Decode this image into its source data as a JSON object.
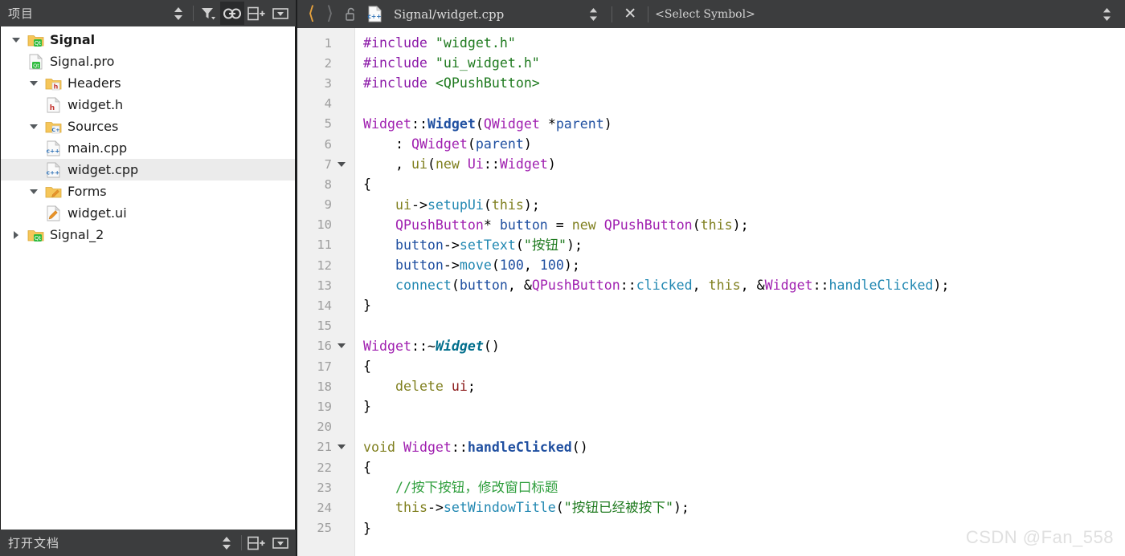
{
  "sidebar": {
    "title": "项目",
    "toolbar": [
      {
        "name": "sort-icon",
        "label": "排序"
      },
      {
        "name": "filter-icon",
        "label": "筛选"
      },
      {
        "name": "link-icon",
        "label": "与编辑器同步",
        "active": true
      },
      {
        "name": "split-add-icon",
        "label": "添加分栏"
      },
      {
        "name": "close-panel-icon",
        "label": "关闭边栏"
      }
    ],
    "tree": [
      {
        "label": "Signal",
        "indent": 0,
        "icon": "qt-folder-icon",
        "twisty": "down",
        "bold": true,
        "selected": false
      },
      {
        "label": "Signal.pro",
        "indent": 1,
        "icon": "qt-pro-file-icon",
        "twisty": "none",
        "bold": false,
        "selected": false
      },
      {
        "label": "Headers",
        "indent": 1,
        "icon": "h-folder-icon",
        "twisty": "down",
        "bold": false,
        "selected": false
      },
      {
        "label": "widget.h",
        "indent": 2,
        "icon": "h-file-icon",
        "twisty": "none",
        "bold": false,
        "selected": false
      },
      {
        "label": "Sources",
        "indent": 1,
        "icon": "cpp-folder-icon",
        "twisty": "down",
        "bold": false,
        "selected": false
      },
      {
        "label": "main.cpp",
        "indent": 2,
        "icon": "cpp-file-icon",
        "twisty": "none",
        "bold": false,
        "selected": false
      },
      {
        "label": "widget.cpp",
        "indent": 2,
        "icon": "cpp-file-icon",
        "twisty": "none",
        "bold": false,
        "selected": true
      },
      {
        "label": "Forms",
        "indent": 1,
        "icon": "ui-folder-icon",
        "twisty": "down",
        "bold": false,
        "selected": false
      },
      {
        "label": "widget.ui",
        "indent": 2,
        "icon": "ui-file-icon",
        "twisty": "none",
        "bold": false,
        "selected": false
      },
      {
        "label": "Signal_2",
        "indent": 0,
        "icon": "qt-folder-icon",
        "twisty": "right",
        "bold": false,
        "selected": false
      }
    ],
    "bottom": {
      "title": "打开文档",
      "toolbar": [
        {
          "name": "sort-icon",
          "label": "排序"
        },
        {
          "name": "split-add-icon",
          "label": "添加分栏"
        },
        {
          "name": "close-panel-icon",
          "label": "关闭边栏"
        }
      ]
    }
  },
  "editor": {
    "toolbar": {
      "back_icon": "chevron-left-icon",
      "forward_icon": "chevron-right-icon",
      "lock_icon": "unlock-icon",
      "file_icon": "cpp-file-icon",
      "filename": "Signal/widget.cpp",
      "file_dropdown_icon": "updown-arrows-icon",
      "close_label": "✕",
      "symbol_selector": "<Select Symbol>",
      "right_dropdown_icon": "updown-arrows-icon"
    },
    "first_line": 1,
    "last_line": 25,
    "fold_lines": [
      7,
      16,
      21
    ],
    "lines": [
      {
        "n": 1,
        "tokens": [
          {
            "t": "#include ",
            "c": "s-pre"
          },
          {
            "t": "\"widget.h\"",
            "c": "s-str"
          }
        ]
      },
      {
        "n": 2,
        "tokens": [
          {
            "t": "#include ",
            "c": "s-pre"
          },
          {
            "t": "\"ui_widget.h\"",
            "c": "s-str"
          }
        ]
      },
      {
        "n": 3,
        "tokens": [
          {
            "t": "#include ",
            "c": "s-pre"
          },
          {
            "t": "<QPushButton>",
            "c": "s-str"
          }
        ]
      },
      {
        "n": 4,
        "tokens": []
      },
      {
        "n": 5,
        "tokens": [
          {
            "t": "Widget",
            "c": "s-type"
          },
          {
            "t": "::",
            "c": "s-plain"
          },
          {
            "t": "Widget",
            "c": "s-fndef"
          },
          {
            "t": "(",
            "c": "s-plain"
          },
          {
            "t": "QWidget",
            "c": "s-type"
          },
          {
            "t": " *",
            "c": "s-plain"
          },
          {
            "t": "parent",
            "c": "s-var"
          },
          {
            "t": ")",
            "c": "s-plain"
          }
        ]
      },
      {
        "n": 6,
        "tokens": [
          {
            "t": "    : ",
            "c": "s-plain"
          },
          {
            "t": "QWidget",
            "c": "s-type"
          },
          {
            "t": "(",
            "c": "s-plain"
          },
          {
            "t": "parent",
            "c": "s-var"
          },
          {
            "t": ")",
            "c": "s-plain"
          }
        ]
      },
      {
        "n": 7,
        "tokens": [
          {
            "t": "    , ",
            "c": "s-plain"
          },
          {
            "t": "ui",
            "c": "s-kw"
          },
          {
            "t": "(",
            "c": "s-plain"
          },
          {
            "t": "new",
            "c": "s-kw"
          },
          {
            "t": " ",
            "c": "s-plain"
          },
          {
            "t": "Ui",
            "c": "s-type"
          },
          {
            "t": "::",
            "c": "s-plain"
          },
          {
            "t": "Widget",
            "c": "s-type"
          },
          {
            "t": ")",
            "c": "s-plain"
          }
        ]
      },
      {
        "n": 8,
        "tokens": [
          {
            "t": "{",
            "c": "s-plain"
          }
        ]
      },
      {
        "n": 9,
        "tokens": [
          {
            "t": "    ",
            "c": "s-plain"
          },
          {
            "t": "ui",
            "c": "s-kw"
          },
          {
            "t": "->",
            "c": "s-plain"
          },
          {
            "t": "setupUi",
            "c": "s-fn"
          },
          {
            "t": "(",
            "c": "s-plain"
          },
          {
            "t": "this",
            "c": "s-kw"
          },
          {
            "t": ");",
            "c": "s-plain"
          }
        ]
      },
      {
        "n": 10,
        "tokens": [
          {
            "t": "    ",
            "c": "s-plain"
          },
          {
            "t": "QPushButton",
            "c": "s-type"
          },
          {
            "t": "* ",
            "c": "s-plain"
          },
          {
            "t": "button",
            "c": "s-var"
          },
          {
            "t": " = ",
            "c": "s-plain"
          },
          {
            "t": "new",
            "c": "s-kw"
          },
          {
            "t": " ",
            "c": "s-plain"
          },
          {
            "t": "QPushButton",
            "c": "s-type"
          },
          {
            "t": "(",
            "c": "s-plain"
          },
          {
            "t": "this",
            "c": "s-kw"
          },
          {
            "t": ");",
            "c": "s-plain"
          }
        ]
      },
      {
        "n": 11,
        "tokens": [
          {
            "t": "    ",
            "c": "s-plain"
          },
          {
            "t": "button",
            "c": "s-var"
          },
          {
            "t": "->",
            "c": "s-plain"
          },
          {
            "t": "setText",
            "c": "s-fn"
          },
          {
            "t": "(",
            "c": "s-plain"
          },
          {
            "t": "\"按钮\"",
            "c": "s-str"
          },
          {
            "t": ");",
            "c": "s-plain"
          }
        ]
      },
      {
        "n": 12,
        "tokens": [
          {
            "t": "    ",
            "c": "s-plain"
          },
          {
            "t": "button",
            "c": "s-var"
          },
          {
            "t": "->",
            "c": "s-plain"
          },
          {
            "t": "move",
            "c": "s-fn"
          },
          {
            "t": "(",
            "c": "s-plain"
          },
          {
            "t": "100",
            "c": "s-num"
          },
          {
            "t": ", ",
            "c": "s-plain"
          },
          {
            "t": "100",
            "c": "s-num"
          },
          {
            "t": ");",
            "c": "s-plain"
          }
        ]
      },
      {
        "n": 13,
        "tokens": [
          {
            "t": "    ",
            "c": "s-plain"
          },
          {
            "t": "connect",
            "c": "s-fn"
          },
          {
            "t": "(",
            "c": "s-plain"
          },
          {
            "t": "button",
            "c": "s-var"
          },
          {
            "t": ", &",
            "c": "s-plain"
          },
          {
            "t": "QPushButton",
            "c": "s-type"
          },
          {
            "t": "::",
            "c": "s-plain"
          },
          {
            "t": "clicked",
            "c": "s-fn"
          },
          {
            "t": ", ",
            "c": "s-plain"
          },
          {
            "t": "this",
            "c": "s-kw"
          },
          {
            "t": ", &",
            "c": "s-plain"
          },
          {
            "t": "Widget",
            "c": "s-type"
          },
          {
            "t": "::",
            "c": "s-plain"
          },
          {
            "t": "handleClicked",
            "c": "s-fn"
          },
          {
            "t": ");",
            "c": "s-plain"
          }
        ]
      },
      {
        "n": 14,
        "tokens": [
          {
            "t": "}",
            "c": "s-plain"
          }
        ]
      },
      {
        "n": 15,
        "tokens": []
      },
      {
        "n": 16,
        "tokens": [
          {
            "t": "Widget",
            "c": "s-type"
          },
          {
            "t": "::~",
            "c": "s-plain"
          },
          {
            "t": "Widget",
            "c": "s-dtor"
          },
          {
            "t": "()",
            "c": "s-plain"
          }
        ]
      },
      {
        "n": 17,
        "tokens": [
          {
            "t": "{",
            "c": "s-plain"
          }
        ]
      },
      {
        "n": 18,
        "tokens": [
          {
            "t": "    ",
            "c": "s-plain"
          },
          {
            "t": "delete",
            "c": "s-kw"
          },
          {
            "t": " ",
            "c": "s-plain"
          },
          {
            "t": "ui",
            "c": "s-mem"
          },
          {
            "t": ";",
            "c": "s-plain"
          }
        ]
      },
      {
        "n": 19,
        "tokens": [
          {
            "t": "}",
            "c": "s-plain"
          }
        ]
      },
      {
        "n": 20,
        "tokens": []
      },
      {
        "n": 21,
        "tokens": [
          {
            "t": "void",
            "c": "s-kw"
          },
          {
            "t": " ",
            "c": "s-plain"
          },
          {
            "t": "Widget",
            "c": "s-type"
          },
          {
            "t": "::",
            "c": "s-plain"
          },
          {
            "t": "handleClicked",
            "c": "s-fndef"
          },
          {
            "t": "()",
            "c": "s-plain"
          }
        ]
      },
      {
        "n": 22,
        "tokens": [
          {
            "t": "{",
            "c": "s-plain"
          }
        ]
      },
      {
        "n": 23,
        "tokens": [
          {
            "t": "    ",
            "c": "s-plain"
          },
          {
            "t": "//按下按钮，修改窗口标题",
            "c": "s-cmt"
          }
        ]
      },
      {
        "n": 24,
        "tokens": [
          {
            "t": "    ",
            "c": "s-plain"
          },
          {
            "t": "this",
            "c": "s-kw"
          },
          {
            "t": "->",
            "c": "s-plain"
          },
          {
            "t": "setWindowTitle",
            "c": "s-fn"
          },
          {
            "t": "(",
            "c": "s-plain"
          },
          {
            "t": "\"按钮已经被按下\"",
            "c": "s-str"
          },
          {
            "t": ");",
            "c": "s-plain"
          }
        ]
      },
      {
        "n": 25,
        "tokens": [
          {
            "t": "}",
            "c": "s-plain"
          }
        ]
      }
    ]
  },
  "watermark": "CSDN @Fan_558",
  "colors": {
    "chrome": "#3c3d3e",
    "chrome_active": "#2a2b2c",
    "editor_bg": "#ffffff",
    "gutter_bg": "#f0f0f0",
    "selection": "#ebebeb",
    "back_arrow": "#e8a33d"
  }
}
